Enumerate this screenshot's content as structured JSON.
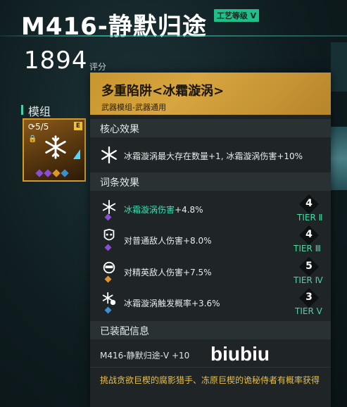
{
  "header": {
    "title": "M416-静默归途",
    "craft_badge": "工艺等级 V",
    "score": "1894",
    "score_label": "评分"
  },
  "section_module": "模组",
  "module_slot": {
    "count": "5/5",
    "grade": "E",
    "gem_colors": [
      "#8a4dd6",
      "#8a4dd6",
      "#e0952a",
      "#3a8fd6"
    ]
  },
  "tooltip": {
    "title": "多重陷阱<冰霜漩涡>",
    "subtitle": "武器模组-武器通用",
    "core_header": "核心效果",
    "core_effect": "冰霜漩涡最大存在数量+1, 冰霜漩涡伤害+10%",
    "affix_header": "词条效果",
    "affixes": [
      {
        "highlight": "冰霜漩涡伤害",
        "text": "+4.8%",
        "tier_num": "4",
        "tier": "TIER Ⅱ",
        "gem": "#8a4dd6"
      },
      {
        "highlight": "",
        "text": "对普通敌人伤害+8.0%",
        "tier_num": "4",
        "tier": "TIER Ⅲ",
        "gem": "#8a4dd6"
      },
      {
        "highlight": "",
        "text": "对精英敌人伤害+7.5%",
        "tier_num": "5",
        "tier": "TIER Ⅳ",
        "gem": "#e0952a"
      },
      {
        "highlight": "",
        "text": "冰霜漩涡触发概率+3.6%",
        "tier_num": "3",
        "tier": "TIER Ⅴ",
        "gem": "#3a8fd6"
      }
    ],
    "equip_header": "已装配信息",
    "equip_weapon": "M416-静默归途-V +10",
    "description": "挑战贪欲巨楔的腐影猎手、冻原巨楔的诡秘侍者有概率获得"
  },
  "watermark": "biubiu",
  "colors": {
    "accent_teal": "#38e0b5",
    "gold": "#d7a640",
    "desc_yellow": "#e7c04a"
  }
}
